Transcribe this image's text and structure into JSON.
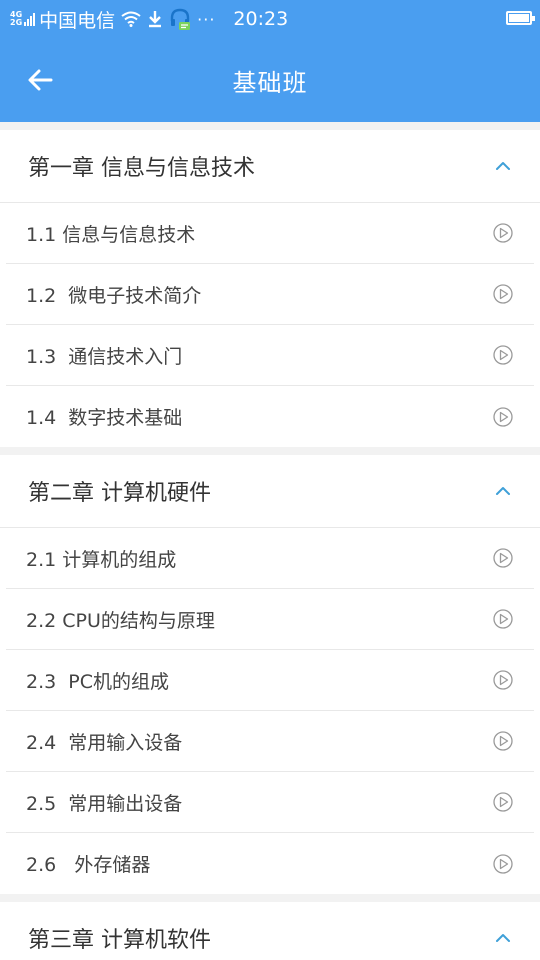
{
  "status_bar": {
    "network_top": "4G",
    "network_bottom": "2G",
    "carrier": "中国电信",
    "dots": "···",
    "time": "20:23"
  },
  "header": {
    "title": "基础班",
    "back_icon": "arrow-left-icon"
  },
  "colors": {
    "accent": "#4a9ef0",
    "chevron": "#3fa0d8",
    "divider": "#e8e8e8",
    "background": "#f2f2f2"
  },
  "chapters": [
    {
      "title": "第一章 信息与信息技术",
      "lessons": [
        {
          "title": "1.1 信息与信息技术"
        },
        {
          "title": "1.2  微电子技术简介"
        },
        {
          "title": "1.3  通信技术入门"
        },
        {
          "title": "1.4  数字技术基础"
        }
      ]
    },
    {
      "title": "第二章  计算机硬件",
      "lessons": [
        {
          "title": "2.1 计算机的组成"
        },
        {
          "title": "2.2 CPU的结构与原理"
        },
        {
          "title": "2.3  PC机的组成"
        },
        {
          "title": "2.4  常用输入设备"
        },
        {
          "title": "2.5  常用输出设备"
        },
        {
          "title": "2.6   外存储器"
        }
      ]
    },
    {
      "title": "第三章  计算机软件",
      "lessons": []
    }
  ]
}
